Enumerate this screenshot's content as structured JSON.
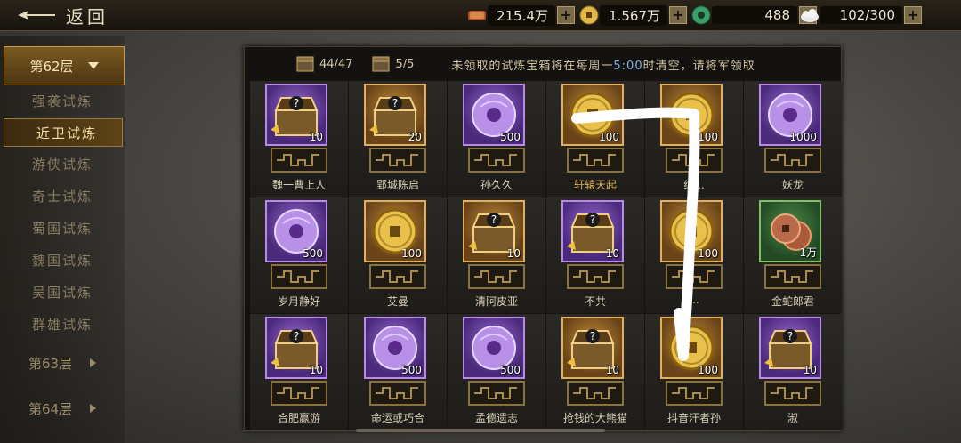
{
  "topbar": {
    "back_label": "返回",
    "resources": [
      {
        "icon": "grain-icon",
        "value": "215.4万"
      },
      {
        "icon": "copper-coin-icon",
        "value": "1.567万"
      },
      {
        "icon": "jade-icon",
        "value": "488"
      },
      {
        "icon": "stamina-cloud-icon",
        "value": "102/300"
      }
    ]
  },
  "sidebar": {
    "active_floor": "第62层",
    "items": [
      {
        "label": "强袭试炼"
      },
      {
        "label": "近卫试炼"
      },
      {
        "label": "游侠试炼"
      },
      {
        "label": "奇士试炼"
      },
      {
        "label": "蜀国试炼"
      },
      {
        "label": "魏国试炼"
      },
      {
        "label": "吴国试炼"
      },
      {
        "label": "群雄试炼"
      }
    ],
    "active_index": 1,
    "floors": [
      {
        "label": "第63层"
      },
      {
        "label": "第64层"
      }
    ]
  },
  "panel": {
    "chest_count_1": "44/47",
    "chest_count_2": "5/5",
    "notice_a": "未领取的试炼宝箱将在每周一",
    "notice_time": "5:00",
    "notice_b": "时清空，请将军领取",
    "cells": [
      {
        "name": "魏一曹上人",
        "qty": "10",
        "frame": "purple",
        "icon": "treasure-chest-icon"
      },
      {
        "name": "郢城陈启",
        "qty": "20",
        "frame": "gold",
        "icon": "treasure-chest-icon"
      },
      {
        "name": "孙久久",
        "qty": "500",
        "frame": "purple",
        "icon": "jade-disc-icon"
      },
      {
        "name": "轩辕天起",
        "qty": "100",
        "frame": "gold",
        "icon": "gold-coin-icon",
        "name_gold": true
      },
      {
        "name": "纵...",
        "qty": "100",
        "frame": "gold",
        "icon": "gold-coin-icon"
      },
      {
        "name": "妖龙",
        "qty": "1000",
        "frame": "purple",
        "icon": "jade-disc-icon"
      },
      {
        "name": "岁月静好",
        "qty": "500",
        "frame": "purple",
        "icon": "jade-disc-icon"
      },
      {
        "name": "艾曼",
        "qty": "100",
        "frame": "gold",
        "icon": "gold-coin-icon"
      },
      {
        "name": "清阿皮亚",
        "qty": "10",
        "frame": "gold",
        "icon": "treasure-chest-icon"
      },
      {
        "name": "不共",
        "qty": "10",
        "frame": "purple",
        "icon": "treasure-chest-icon"
      },
      {
        "name": "...",
        "qty": "100",
        "frame": "gold",
        "icon": "gold-coin-icon"
      },
      {
        "name": "金蛇郎君",
        "qty": "1万",
        "frame": "green",
        "icon": "copper-coins-icon"
      },
      {
        "name": "合肥赢游",
        "qty": "10",
        "frame": "purple",
        "icon": "treasure-chest-icon"
      },
      {
        "name": "命运或巧合",
        "qty": "500",
        "frame": "purple",
        "icon": "jade-disc-icon"
      },
      {
        "name": "孟德遗志",
        "qty": "500",
        "frame": "purple",
        "icon": "jade-disc-icon"
      },
      {
        "name": "抢钱的大熊猫",
        "qty": "10",
        "frame": "gold",
        "icon": "treasure-chest-icon"
      },
      {
        "name": "抖音汗者孙",
        "qty": "100",
        "frame": "gold",
        "icon": "gold-coin-icon"
      },
      {
        "name": "淑",
        "qty": "10",
        "frame": "purple",
        "icon": "treasure-chest-icon"
      }
    ]
  }
}
